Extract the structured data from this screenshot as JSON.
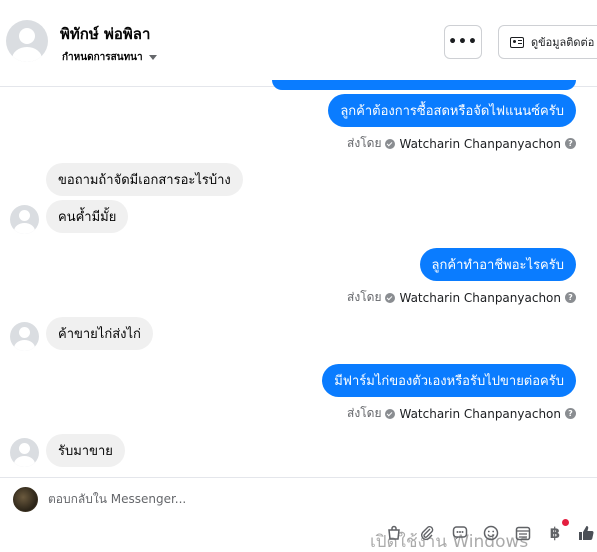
{
  "header": {
    "contact_name": "พิทักษ์ พ่อพิลา",
    "label_action": "กำหนดการสนทนา",
    "more_label": "•••",
    "view_contact_label": "ดูข้อมูลติดต่อ"
  },
  "messages": [
    {
      "direction": "out",
      "text": "ลูกค้าต้องการซื้อสดหรือจัดไฟแนนซ์ครับ"
    },
    {
      "direction": "in",
      "text": "ขอถามถ้าจัดมีเอกสารอะไรบ้าง"
    },
    {
      "direction": "in",
      "text": "คนค้ำมีมั้ย"
    },
    {
      "direction": "out",
      "text": "ลูกค้าทำอาชีพอะไรครับ"
    },
    {
      "direction": "in",
      "text": "ค้าขายไก่ส่งไก่"
    },
    {
      "direction": "out",
      "text": "มีฟาร์มไก่ของตัวเองหรือรับไปขายต่อครับ"
    },
    {
      "direction": "in",
      "text": "รับมาขาย"
    }
  ],
  "sent_by": {
    "prefix": "ส่งโดย",
    "sender": "Watcharin Chanpanyachon",
    "help": "?"
  },
  "composer": {
    "placeholder": "ตอบกลับใน Messenger...",
    "watermark": "เปิดใช้งาน Windows"
  },
  "icons": [
    "bag-icon",
    "paperclip-icon",
    "message-template-icon",
    "emoji-icon",
    "calendar-icon",
    "baht-icon",
    "like-icon"
  ],
  "colors": {
    "outgoing_bubble": "#0a7cff",
    "incoming_bubble": "#f0f0f0",
    "notification_dot": "#e41e3f"
  }
}
